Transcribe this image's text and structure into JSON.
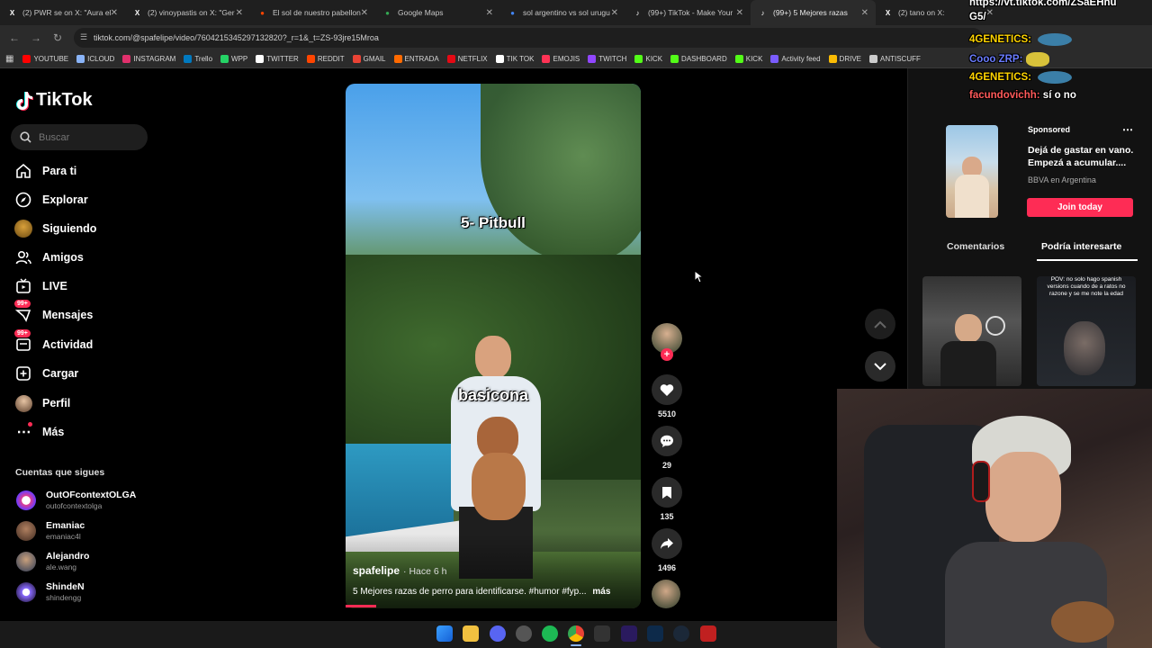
{
  "browser": {
    "tabs": [
      {
        "title": "(2) PWR se on X: \"Aura el",
        "icon": "x-icon",
        "color": "#ffffff",
        "active": false
      },
      {
        "title": "(2) vinoypastis on X: \"Ger",
        "icon": "x-icon",
        "color": "#ffffff",
        "active": false
      },
      {
        "title": "El sol de nuestro pabellon",
        "icon": "reddit-icon",
        "color": "#ff4500",
        "active": false
      },
      {
        "title": "Google Maps",
        "icon": "maps-pin-icon",
        "color": "#34a853",
        "active": false
      },
      {
        "title": "sol argentino vs sol urugu",
        "icon": "google-icon",
        "color": "#4285f4",
        "active": false
      },
      {
        "title": "(99+) TikTok - Make Your",
        "icon": "tiktok-icon",
        "color": "#ffffff",
        "active": false
      },
      {
        "title": "(99+) 5 Mejores razas",
        "icon": "tiktok-icon",
        "color": "#ffffff",
        "active": true
      },
      {
        "title": "(2) tano on X:",
        "icon": "x-icon",
        "color": "#ffffff",
        "active": false
      }
    ],
    "url": "tiktok.com/@spafelipe/video/7604215345297132820?_r=1&_t=ZS-93jre15Mroa",
    "bookmarks": [
      {
        "label": "YOUTUBE",
        "color": "#ff0000"
      },
      {
        "label": "ICLOUD",
        "color": "#8ab4f8"
      },
      {
        "label": "INSTAGRAM",
        "color": "#e1306c"
      },
      {
        "label": "Trello",
        "color": "#0079bf"
      },
      {
        "label": "WPP",
        "color": "#25d366"
      },
      {
        "label": "TWITTER",
        "color": "#ffffff"
      },
      {
        "label": "REDDIT",
        "color": "#ff4500"
      },
      {
        "label": "GMAIL",
        "color": "#ea4335"
      },
      {
        "label": "ENTRADA",
        "color": "#ff6a00"
      },
      {
        "label": "NETFLIX",
        "color": "#e50914"
      },
      {
        "label": "TIK TOK",
        "color": "#ffffff"
      },
      {
        "label": "EMOJIS",
        "color": "#ff3355"
      },
      {
        "label": "TWITCH",
        "color": "#9146ff"
      },
      {
        "label": "KICK",
        "color": "#53fc18"
      },
      {
        "label": "DASHBOARD",
        "color": "#53fc18"
      },
      {
        "label": "KICK",
        "color": "#53fc18"
      },
      {
        "label": "Activity feed",
        "color": "#7a5cff"
      },
      {
        "label": "DRIVE",
        "color": "#fbbc04"
      },
      {
        "label": "ANTISCUFF",
        "color": "#cccccc"
      }
    ]
  },
  "tiktok": {
    "logo": "TikTok",
    "search_placeholder": "Buscar",
    "nav": {
      "para_ti": "Para ti",
      "explorar": "Explorar",
      "siguiendo": "Siguiendo",
      "amigos": "Amigos",
      "live": "LIVE",
      "mensajes": "Mensajes",
      "actividad": "Actividad",
      "cargar": "Cargar",
      "perfil": "Perfil",
      "mas": "Más"
    },
    "badges": {
      "mensajes": "99+",
      "actividad": "99+"
    },
    "following_title": "Cuentas que sigues",
    "following": [
      {
        "name": "OutOFcontextOLGA",
        "handle": "outofcontextolga"
      },
      {
        "name": "Emaniac",
        "handle": "emaniac4l"
      },
      {
        "name": "Alejandro",
        "handle": "ale.wang"
      },
      {
        "name": "ShindeN",
        "handle": "shindengg"
      }
    ],
    "video": {
      "caption_top": "5- Pitbull",
      "caption_mid": "basicona",
      "author": "spafelipe",
      "time": "· Hace 6 h",
      "description": "5 Mejores razas de perro para identificarse. #humor #fyp...",
      "more": "más"
    },
    "actions": {
      "likes": "5510",
      "comments": "29",
      "saves": "135",
      "shares": "1496"
    },
    "ad": {
      "sponsored": "Sponsored",
      "text": "Dejá de gastar en vano. Empezá a acumular....",
      "brand": "BBVA en Argentina",
      "cta": "Join today"
    },
    "tabs": {
      "comments": "Comentarios",
      "suggested": "Podría interesarte"
    },
    "thumb_caption": "POV: no solo hago spanish versions cuando de a ratos no razone y se me note la edad"
  },
  "stream": {
    "chat": [
      {
        "user": "https://vt.tiktok.com/ZSaEHhu",
        "text": "",
        "color": "#ffffff"
      },
      {
        "user": "G5/",
        "text": "",
        "color": "#ffffff"
      },
      {
        "user": "4GENETICS:",
        "text": "",
        "color": "#ffd400"
      },
      {
        "user": "Cooo ZRP:",
        "text": "",
        "color": "#6a7cff"
      },
      {
        "user": "4GENETICS:",
        "text": "",
        "color": "#ffd400"
      },
      {
        "user": "facundovichh:",
        "text": "sí o no",
        "color": "#ff5a5a"
      }
    ]
  }
}
